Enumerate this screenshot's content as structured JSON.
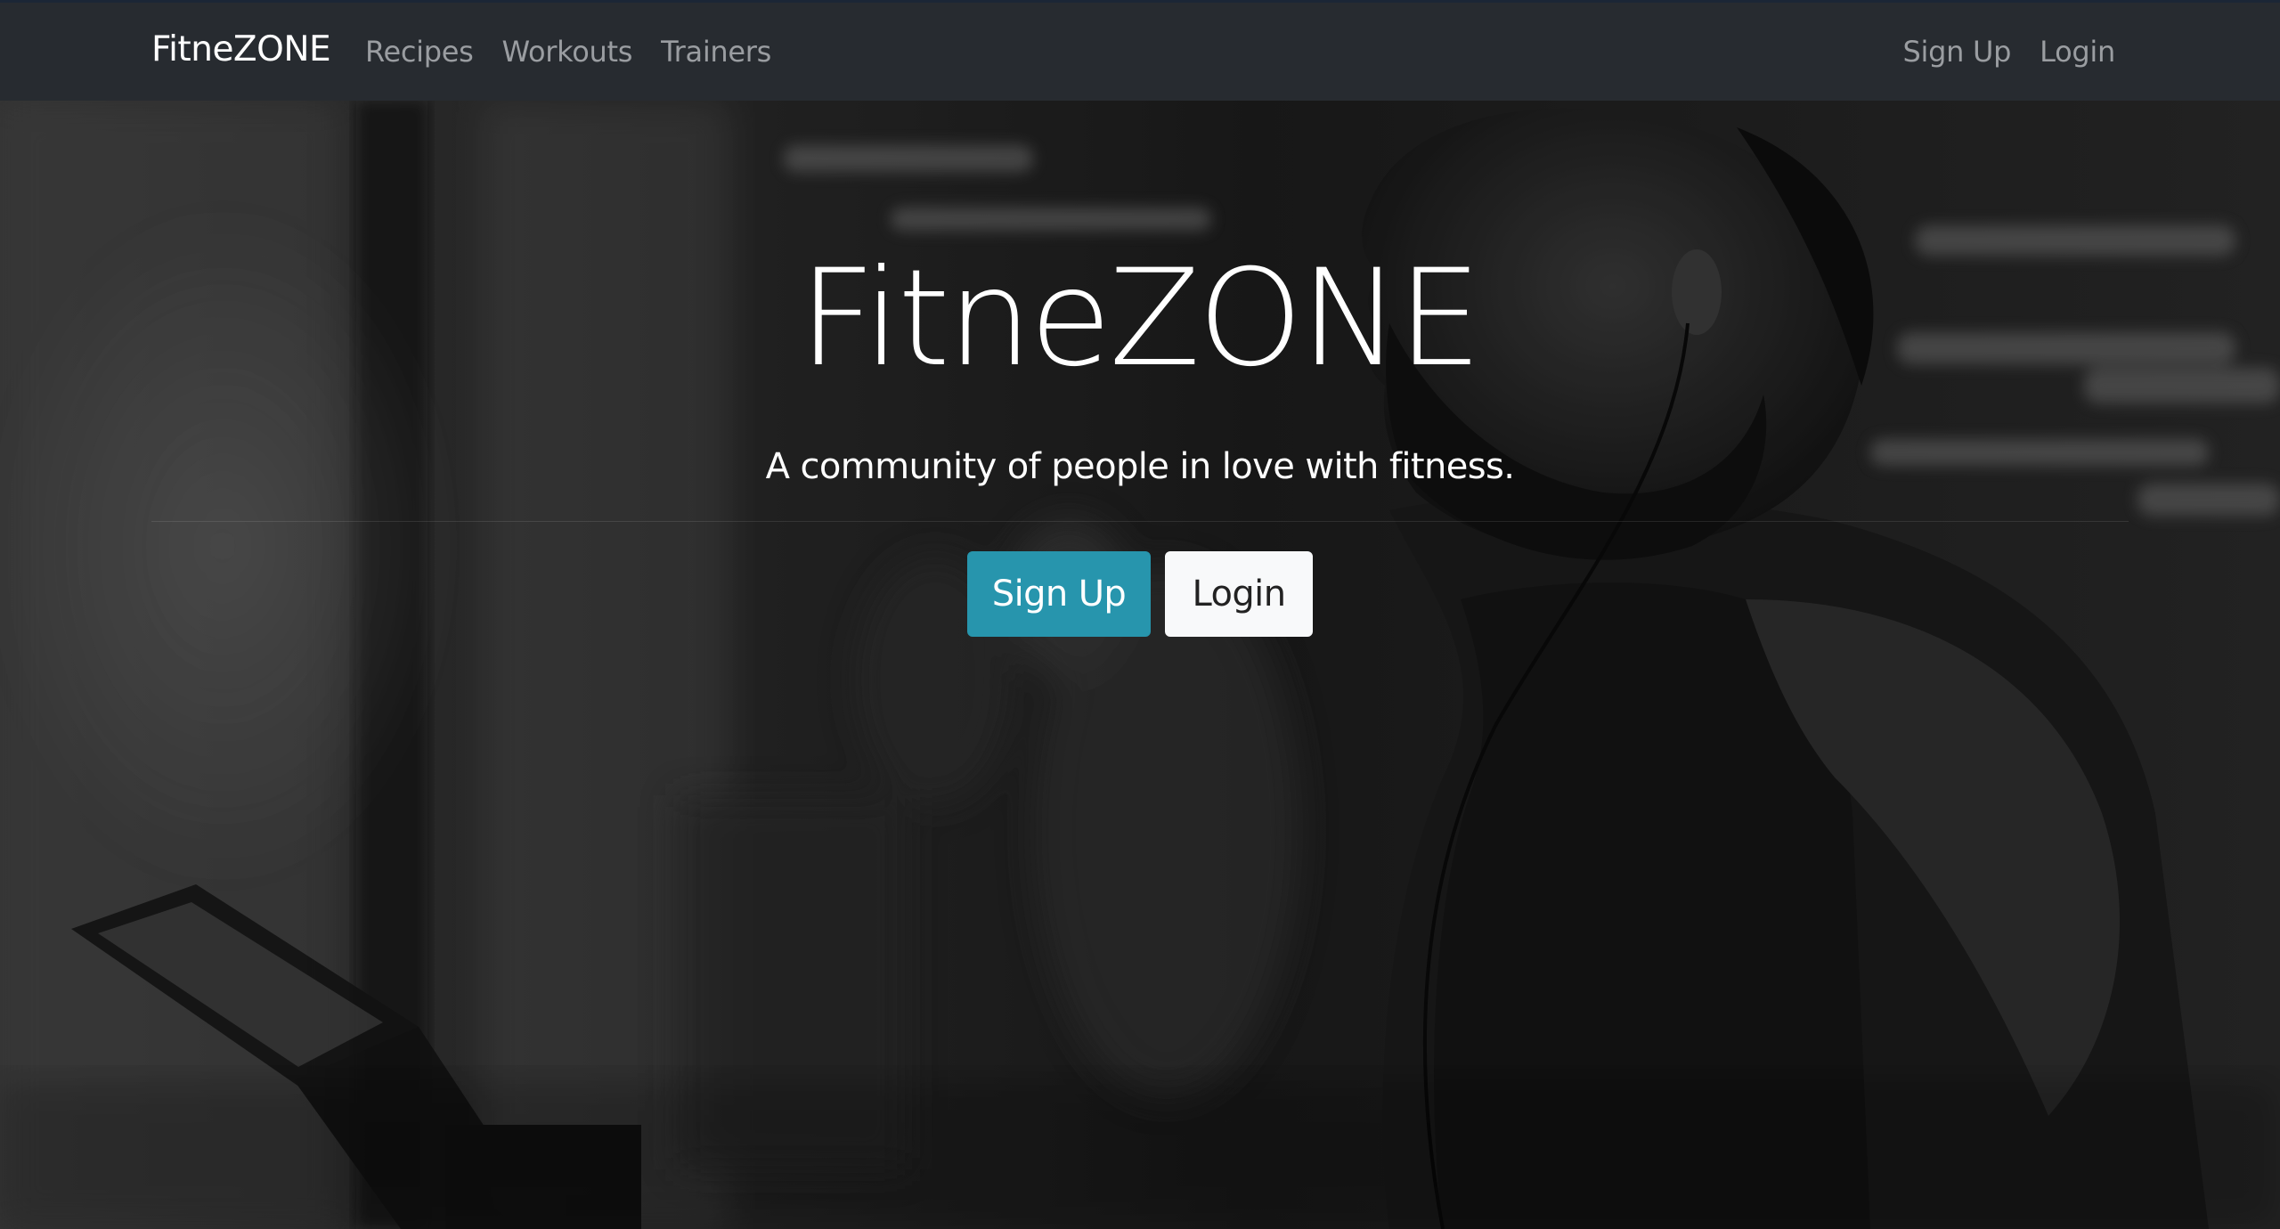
{
  "navbar": {
    "brand": "FitneZONE",
    "left_links": [
      "Recipes",
      "Workouts",
      "Trainers"
    ],
    "right_links": [
      "Sign Up",
      "Login"
    ]
  },
  "hero": {
    "title": "FitneZONE",
    "subtitle": "A community of people in love with fitness.",
    "signup_button": "Sign Up",
    "login_button": "Login"
  },
  "colors": {
    "navbar_bg": "#272b30",
    "nav_link": "#9a9da1",
    "primary_button": "#2795ad",
    "secondary_button": "#f8f9fa"
  }
}
